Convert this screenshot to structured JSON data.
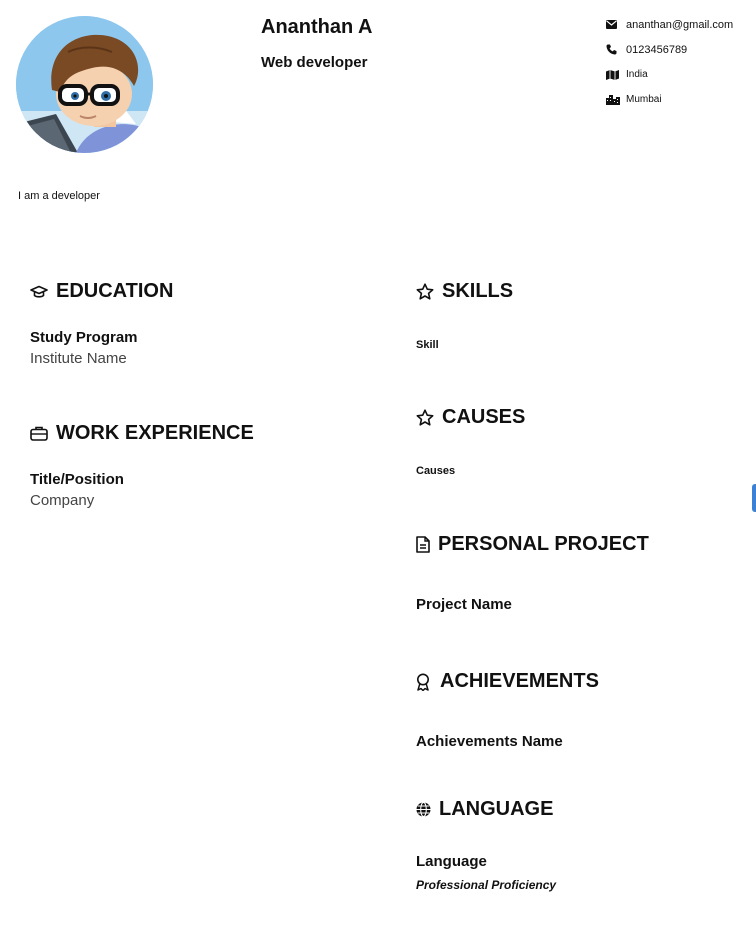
{
  "profile": {
    "name": "Ananthan A",
    "title": "Web developer",
    "about": "I am a developer"
  },
  "contact": {
    "email": "ananthan@gmail.com",
    "phone": "0123456789",
    "country": "India",
    "city": "Mumbai"
  },
  "education": {
    "heading": "EDUCATION",
    "study_program": "Study Program",
    "institute": "Institute Name"
  },
  "work": {
    "heading": "WORK EXPERIENCE",
    "title": "Title/Position",
    "company": "Company"
  },
  "skills": {
    "heading": "SKILLS",
    "item": "Skill"
  },
  "causes": {
    "heading": "CAUSES",
    "item": "Causes"
  },
  "project": {
    "heading": "PERSONAL PROJECT",
    "name": "Project Name"
  },
  "achievements": {
    "heading": "ACHIEVEMENTS",
    "name": "Achievements Name"
  },
  "language": {
    "heading": "LANGUAGE",
    "name": "Language",
    "proficiency": "Professional Proficiency"
  },
  "icons": {
    "email": "envelope-icon",
    "phone": "phone-icon",
    "country": "map-icon",
    "city": "city-icon",
    "education": "graduation-cap-icon",
    "work": "briefcase-icon",
    "skills": "star-icon",
    "causes": "star-icon",
    "project": "document-icon",
    "achievements": "award-icon",
    "language": "globe-icon"
  },
  "colors": {
    "text": "#111111",
    "muted": "#444444",
    "scroll_handle": "#3b82d6"
  }
}
